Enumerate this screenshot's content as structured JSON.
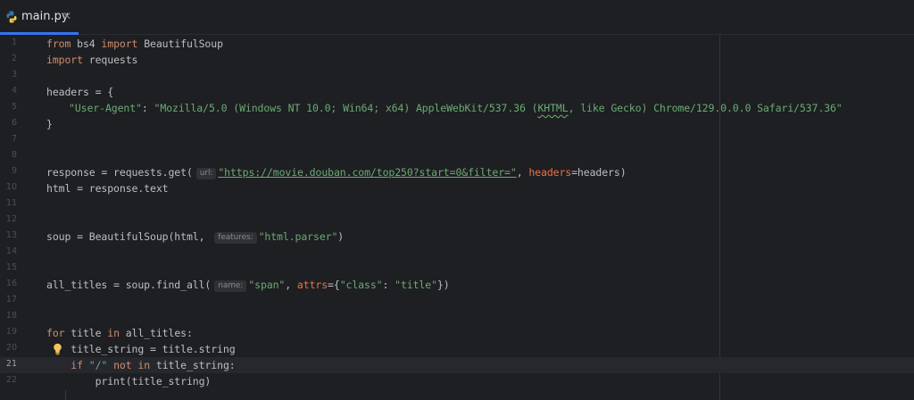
{
  "tab": {
    "filename": "main.py",
    "close_glyph": "✕",
    "icon": "python-file-icon",
    "accent_color": "#3574f0"
  },
  "editor": {
    "current_line": "21",
    "line_numbers": [
      "1",
      "2",
      "3",
      "4",
      "5",
      "6",
      "7",
      "8",
      "9",
      "10",
      "11",
      "12",
      "13",
      "14",
      "15",
      "16",
      "17",
      "18",
      "19",
      "20",
      "21",
      "22"
    ],
    "tokens": {
      "l1": [
        "from",
        " bs4 ",
        "import",
        " BeautifulSoup"
      ],
      "l2": [
        "import",
        " requests"
      ],
      "l4": "headers = {",
      "l5": [
        "\"User-Agent\"",
        ": ",
        "\"Mozilla/5.0 (Windows NT 10.0; Win64; x64) AppleWebKit/537.36 (",
        "KHTML",
        ", like Gecko) Chrome/129.0.0.0 Safari/537.36\""
      ],
      "l6": "}",
      "l9": [
        "response = requests.get(",
        "url:",
        "\"https://movie.douban.com/top250?start=0&filter=\"",
        ", ",
        "headers",
        "=headers)"
      ],
      "l10": "html = response.text",
      "l13": [
        "soup = BeautifulSoup(html, ",
        "features:",
        "\"html.parser\"",
        ")"
      ],
      "l16": [
        "all_titles = soup.find_all(",
        "name:",
        "\"span\"",
        ", ",
        "attrs",
        "={",
        "\"class\"",
        ": ",
        "\"title\"",
        "})"
      ],
      "l19": [
        "for",
        " title ",
        "in",
        " all_titles:"
      ],
      "l20": "    title_string = title.string",
      "l21": [
        "    ",
        "if",
        " ",
        "\"/\"",
        " ",
        "not",
        " ",
        "in",
        " title_string:"
      ],
      "l22": "        print(title_string)"
    },
    "colors": {
      "keyword": "#cf8e6d",
      "string": "#6aab73",
      "named_arg": "#e8744a",
      "default": "#bcbec4"
    },
    "gutter_icon": "lightbulb-icon"
  }
}
